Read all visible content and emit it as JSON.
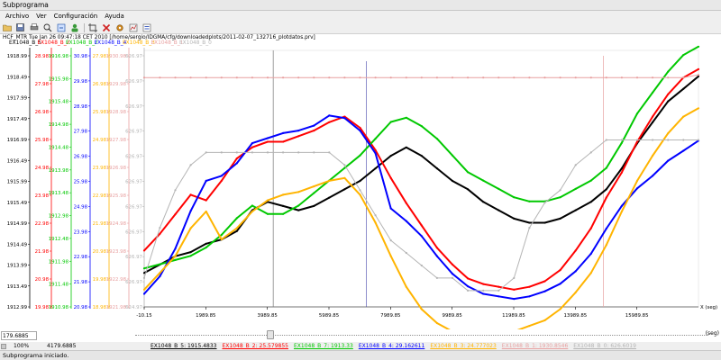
{
  "window": {
    "title": "Subprograma"
  },
  "menu": {
    "items": [
      "Archivo",
      "Ver",
      "Configuración",
      "Ayuda"
    ]
  },
  "toolbar": {
    "buttons": [
      "open",
      "save",
      "print",
      "zoom-in",
      "zoom-fit",
      "user",
      "crop",
      "clear",
      "settings",
      "export",
      "help"
    ]
  },
  "plot": {
    "header": "HCF_MTR Tue Jan 26 09:47:18 CET 2010 [/home/sergio/IDGMA/cfg/downloadedplots/2011-02-07_132716_plotdatos.prv]",
    "legend_top": [
      {
        "label": "EX1048_B_5",
        "color": "#000000"
      },
      {
        "label": "EX1048_B_2",
        "color": "#ff0000"
      },
      {
        "label": "EX1048_B_7",
        "color": "#00c800"
      },
      {
        "label": "EX1048_B_4",
        "color": "#0000ff"
      },
      {
        "label": "EX1048_B_3",
        "color": "#ffb400"
      },
      {
        "label": "EX1048_B_1",
        "color": "#e8a0a0"
      },
      {
        "label": "EX1048_B_0",
        "color": "#b4b4b4"
      }
    ],
    "axes": {
      "black": {
        "color": "#000000",
        "ticks": [
          "1918.99",
          "1918.49",
          "1917.99",
          "1917.49",
          "1916.99",
          "1916.49",
          "1915.99",
          "1915.49",
          "1914.99",
          "1914.49",
          "1913.99",
          "1913.49",
          "1912.99"
        ]
      },
      "red": {
        "color": "#ff0000",
        "ticks": [
          "28.98",
          "27.98",
          "26.98",
          "25.98",
          "24.98",
          "23.98",
          "22.98",
          "21.98",
          "20.98",
          "19.98"
        ]
      },
      "green": {
        "color": "#00c800",
        "ticks": [
          "1916.98",
          "1915.98",
          "1915.48",
          "1914.98",
          "1914.48",
          "1913.98",
          "1913.48",
          "1912.98",
          "1912.48",
          "1911.98",
          "1911.48",
          "1910.98"
        ]
      },
      "blue": {
        "color": "#0000ff",
        "ticks": [
          "30.98",
          "29.98",
          "28.98",
          "27.98",
          "26.98",
          "25.98",
          "24.98",
          "23.98",
          "22.98",
          "21.98",
          "20.98"
        ]
      },
      "orange": {
        "color": "#ffb400",
        "ticks": [
          "27.98",
          "26.98",
          "25.98",
          "24.98",
          "23.98",
          "22.98",
          "21.98",
          "20.98",
          "19.98",
          "18.98"
        ]
      },
      "pink": {
        "color": "#e8a0a0",
        "ticks": [
          "1930.98",
          "1929.98",
          "1928.98",
          "1927.98",
          "1926.98",
          "1925.98",
          "1924.98",
          "1923.98",
          "1922.98",
          "1921.98"
        ]
      },
      "gray": {
        "color": "#b4b4b4",
        "ticks": [
          "626.97",
          "626.97",
          "626.97",
          "626.97",
          "626.97",
          "626.97",
          "626.97",
          "626.97",
          "626.97",
          "626.97",
          "624.97"
        ]
      }
    },
    "x_ticks": [
      "-10.15",
      "1989.85",
      "3989.85",
      "5989.85",
      "7989.85",
      "9989.85",
      "11989.85",
      "13989.85",
      "15989.85"
    ],
    "x_label": "X (seg)"
  },
  "chart_data": {
    "type": "scatter",
    "xlabel": "X (seg)",
    "xlim": [
      -10.15,
      17989.85
    ],
    "x": [
      -10,
      500,
      1000,
      1500,
      2000,
      2500,
      3000,
      3500,
      4000,
      4500,
      5000,
      5500,
      6000,
      6500,
      7000,
      7500,
      8000,
      8500,
      9000,
      9500,
      10000,
      10500,
      11000,
      11500,
      12000,
      12500,
      13000,
      13500,
      14000,
      14500,
      15000,
      15500,
      16000,
      16500,
      17000,
      17500,
      17990
    ],
    "series": [
      {
        "name": "EX1048_B_5",
        "color": "#000000",
        "values": [
          1913.8,
          1914.0,
          1914.2,
          1914.3,
          1914.5,
          1914.6,
          1914.8,
          1915.3,
          1915.5,
          1915.4,
          1915.3,
          1915.4,
          1915.6,
          1915.8,
          1916.0,
          1916.3,
          1916.6,
          1916.8,
          1916.6,
          1916.3,
          1916.0,
          1915.8,
          1915.5,
          1915.3,
          1915.1,
          1915.0,
          1915.0,
          1915.1,
          1915.3,
          1915.5,
          1915.8,
          1916.3,
          1916.9,
          1917.4,
          1917.9,
          1918.2,
          1918.5
        ]
      },
      {
        "name": "EX1048_B_2",
        "color": "#ff0000",
        "values": [
          22.0,
          22.6,
          23.3,
          24.0,
          23.8,
          24.5,
          25.3,
          25.7,
          25.9,
          25.9,
          26.1,
          26.3,
          26.6,
          26.8,
          26.4,
          25.6,
          24.6,
          23.7,
          22.9,
          22.1,
          21.5,
          21.0,
          20.8,
          20.7,
          20.6,
          20.7,
          20.9,
          21.3,
          22.0,
          22.8,
          23.9,
          24.8,
          25.9,
          26.8,
          27.6,
          28.2,
          28.5
        ]
      },
      {
        "name": "EX1048_B_7",
        "color": "#00c800",
        "values": [
          1911.9,
          1912.0,
          1912.1,
          1912.2,
          1912.4,
          1912.7,
          1913.1,
          1913.4,
          1913.2,
          1913.2,
          1913.4,
          1913.7,
          1914.0,
          1914.3,
          1914.6,
          1915.0,
          1915.4,
          1915.5,
          1915.3,
          1915.0,
          1914.6,
          1914.2,
          1914.0,
          1913.8,
          1913.6,
          1913.5,
          1913.5,
          1913.6,
          1913.8,
          1914.0,
          1914.3,
          1914.9,
          1915.6,
          1916.1,
          1916.6,
          1917.0,
          1917.2
        ]
      },
      {
        "name": "EX1048_B_4",
        "color": "#0000ff",
        "values": [
          21.5,
          22.2,
          23.3,
          24.8,
          26.0,
          26.2,
          26.7,
          27.5,
          27.7,
          27.9,
          28.0,
          28.2,
          28.6,
          28.5,
          28.0,
          27.1,
          24.9,
          24.4,
          23.8,
          23.0,
          22.3,
          21.8,
          21.5,
          21.4,
          21.3,
          21.4,
          21.6,
          21.9,
          22.4,
          23.1,
          24.1,
          25.0,
          25.7,
          26.2,
          26.8,
          27.2,
          27.6
        ]
      },
      {
        "name": "EX1048_B_3",
        "color": "#ffb400",
        "values": [
          19.6,
          20.2,
          20.8,
          21.8,
          22.4,
          21.4,
          21.8,
          22.4,
          22.8,
          23.0,
          23.1,
          23.3,
          23.5,
          23.6,
          23.0,
          22.0,
          20.8,
          19.7,
          18.9,
          18.4,
          18.1,
          18.0,
          18.0,
          18.0,
          18.1,
          18.3,
          18.5,
          18.9,
          19.5,
          20.2,
          21.2,
          22.4,
          23.5,
          24.4,
          25.2,
          25.8,
          26.1
        ]
      },
      {
        "name": "EX1048_B_1",
        "color": "#e8a0a0",
        "values": [
          1930.2,
          1930.2,
          1930.2,
          1930.2,
          1930.2,
          1930.2,
          1930.2,
          1930.2,
          1930.2,
          1930.2,
          1930.2,
          1930.2,
          1930.2,
          1930.2,
          1930.2,
          1930.2,
          1930.2,
          1930.2,
          1930.2,
          1930.2,
          1930.2,
          1930.2,
          1930.2,
          1930.2,
          1930.2,
          1930.2,
          1930.2,
          1930.2,
          1930.2,
          1930.2,
          1930.2,
          1930.2,
          1930.2,
          1930.2,
          1930.2,
          1930.2,
          1930.3
        ]
      },
      {
        "name": "EX1048_B_0",
        "color": "#b4b4b4",
        "values": [
          625.2,
          625.6,
          625.9,
          626.1,
          626.2,
          626.2,
          626.2,
          626.2,
          626.2,
          626.2,
          626.2,
          626.2,
          626.2,
          626.1,
          625.9,
          625.7,
          625.5,
          625.4,
          625.3,
          625.2,
          625.2,
          625.1,
          625.1,
          625.1,
          625.2,
          625.6,
          625.8,
          625.9,
          626.1,
          626.2,
          626.3,
          626.3,
          626.3,
          626.3,
          626.3,
          626.3,
          626.3
        ]
      }
    ]
  },
  "scroll": {
    "value": "179.6885",
    "unit": "(seg)"
  },
  "status": {
    "zoom": "100%",
    "position": "4179.6885",
    "legend": [
      {
        "text": "EX1048_B_5: 1915.4833",
        "color": "#000000"
      },
      {
        "text": "EX1048_B_2: 25.579855",
        "color": "#ff0000"
      },
      {
        "text": "EX1048_B_7: 1913.33",
        "color": "#00c800"
      },
      {
        "text": "EX1048_B_4: 29.162611",
        "color": "#0000ff"
      },
      {
        "text": "EX1048_B_3: 24.777023",
        "color": "#ffb400"
      },
      {
        "text": "EX1048_B_1: 1930.8546",
        "color": "#e8a0a0"
      },
      {
        "text": "EX1048_B_0: 626.6019",
        "color": "#b4b4b4"
      }
    ]
  },
  "message": "Subprograma iniciado."
}
